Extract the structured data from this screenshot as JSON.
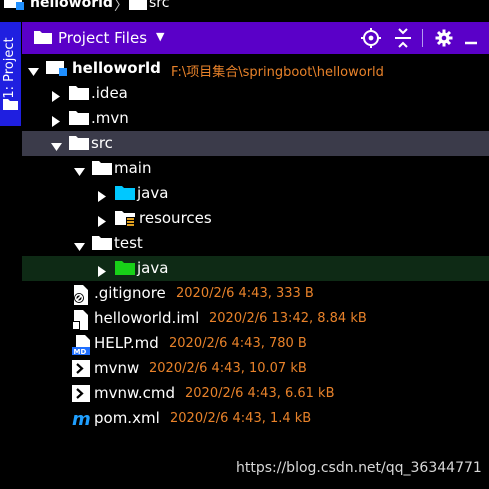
{
  "breadcrumb": {
    "root": "helloworld",
    "separator": "〉",
    "leaf": "src"
  },
  "side_tab": {
    "label": "1: Project"
  },
  "panel": {
    "title": "Project Files",
    "buttons": [
      "target-icon",
      "collapse-icon",
      "gear-icon",
      "hide-icon"
    ]
  },
  "tree": [
    {
      "name": "helloworld",
      "meta": "F:\\项目集合\\springboot\\helloworld",
      "expanded": true,
      "icon": "module-folder-icon"
    },
    {
      "name": ".idea",
      "expanded": false,
      "icon": "folder-icon"
    },
    {
      "name": ".mvn",
      "expanded": false,
      "icon": "folder-icon"
    },
    {
      "name": "src",
      "expanded": true,
      "icon": "folder-icon",
      "selected": true
    },
    {
      "name": "main",
      "expanded": true,
      "icon": "folder-icon"
    },
    {
      "name": "java",
      "expanded": false,
      "icon": "source-folder-icon"
    },
    {
      "name": "resources",
      "expanded": false,
      "icon": "resources-folder-icon"
    },
    {
      "name": "test",
      "expanded": true,
      "icon": "folder-icon"
    },
    {
      "name": "java",
      "expanded": false,
      "icon": "test-folder-icon"
    },
    {
      "name": ".gitignore",
      "meta": "2020/2/6 4:43, 333 B",
      "icon": "gitignore-file-icon"
    },
    {
      "name": "helloworld.iml",
      "meta": "2020/2/6 13:42, 8.84 kB",
      "icon": "iml-file-icon"
    },
    {
      "name": "HELP.md",
      "meta": "2020/2/6 4:43, 780 B",
      "icon": "markdown-file-icon"
    },
    {
      "name": "mvnw",
      "meta": "2020/2/6 4:43, 10.07 kB",
      "icon": "script-file-icon"
    },
    {
      "name": "mvnw.cmd",
      "meta": "2020/2/6 4:43, 6.61 kB",
      "icon": "cmd-file-icon"
    },
    {
      "name": "pom.xml",
      "meta": "2020/2/6 4:43, 1.4 kB",
      "icon": "maven-file-icon"
    }
  ],
  "watermark": "https://blog.csdn.net/qq_36344771",
  "colors": {
    "header": "#5a00c8",
    "side_tab": "#1f1fe0",
    "meta_text": "#e8822a",
    "source_folder": "#00c8ff",
    "test_folder": "#18d018",
    "selected_row": "#3b3b4a",
    "focus_row": "#0e2a15"
  }
}
